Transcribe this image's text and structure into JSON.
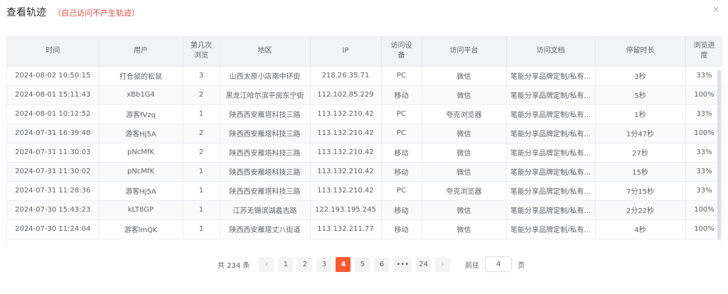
{
  "dialog": {
    "title": "查看轨迹",
    "subtitle": "（自己访问不产生轨迹）",
    "close_icon": "×"
  },
  "table": {
    "columns": [
      "时间",
      "用户",
      "第几次\n浏览",
      "地区",
      "IP",
      "访问设\n备",
      "访问平台",
      "访问文档",
      "停留时长",
      "浏览进\n度"
    ],
    "rows": [
      [
        "2024-08-02 10:50:15",
        "打仓鼠的松鼠",
        "3",
        "山西太原小店南中环街",
        "218.26.35.71",
        "PC",
        "微信",
        "笔能分享品牌定制/私有...",
        "3秒",
        "33%"
      ],
      [
        "2024-08-01 15:11:43",
        "xBb1G4",
        "2",
        "黑龙江哈尔滨平房东宁街",
        "112.102.85.229",
        "移动",
        "微信",
        "笔能分享品牌定制/私有...",
        "5秒",
        "100%"
      ],
      [
        "2024-08-01 10:12:52",
        "游客fVzq",
        "1",
        "陕西西安雁塔科技三路",
        "113.132.210.42",
        "PC",
        "夸克浏览器",
        "笔能分享品牌定制/私有...",
        "1秒",
        "33%"
      ],
      [
        "2024-07-31 16:39:48",
        "游客Hj5A",
        "2",
        "陕西西安雁塔科技三路",
        "113.132.210.42",
        "PC",
        "微信",
        "笔能分享品牌定制/私有...",
        "1分47秒",
        "100%"
      ],
      [
        "2024-07-31 11:30:03",
        "pNcMfK",
        "2",
        "陕西西安雁塔科技三路",
        "113.132.210.42",
        "移动",
        "微信",
        "笔能分享品牌定制/私有...",
        "27秒",
        "33%"
      ],
      [
        "2024-07-31 11:30:02",
        "pNcMfK",
        "1",
        "陕西西安雁塔科技三路",
        "113.132.210.42",
        "移动",
        "微信",
        "笔能分享品牌定制/私有...",
        "15秒",
        "33%"
      ],
      [
        "2024-07-31 11:28:36",
        "游客Hj5A",
        "1",
        "陕西西安雁塔科技三路",
        "113.132.210.42",
        "PC",
        "夸克浏览器",
        "笔能分享品牌定制/私有...",
        "7分15秒",
        "33%"
      ],
      [
        "2024-07-30 15:43:23",
        "kLT8GP",
        "1",
        "江苏无锡滨湖蠡吉路",
        "122.193.195.245",
        "移动",
        "微信",
        "笔能分享品牌定制/私有...",
        "2分22秒",
        "100%"
      ],
      [
        "2024-07-30 11:24:04",
        "游客lmQK",
        "1",
        "陕西西安雁塔丈八街道",
        "113.132.211.77",
        "移动",
        "微信",
        "笔能分享品牌定制/私有...",
        "4秒",
        "100%"
      ]
    ]
  },
  "pagination": {
    "total_text": "共 234 条",
    "prev_icon": "‹",
    "next_icon": "›",
    "pages": [
      "1",
      "2",
      "3",
      "4",
      "5",
      "6",
      "•••",
      "24"
    ],
    "current": "4",
    "goto_label": "前往",
    "goto_value": "4",
    "page_suffix": "页",
    "active_color": "#ff5a35"
  }
}
